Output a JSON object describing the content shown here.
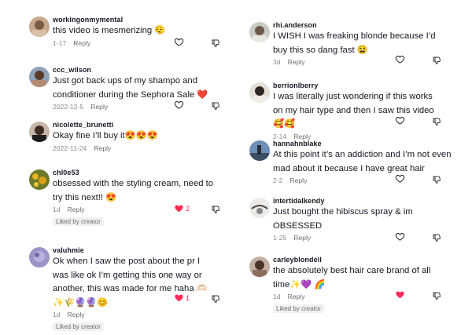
{
  "left_column": [
    {
      "username": "workingonmymental",
      "text": "this video is mesmerizing 😮‍💨",
      "date": "1-17",
      "reply": "Reply",
      "likes": "",
      "liked_by_creator": ""
    },
    {
      "username": "ccc_wilson",
      "text": "Just got back ups of my shampo and conditioner during the Sephora Sale ❤️",
      "date": "2022-12-5",
      "reply": "Reply",
      "likes": "",
      "liked_by_creator": ""
    },
    {
      "username": "nicolette_brunetti",
      "text": "Okay fine I’ll buy it😍😍😍",
      "date": "2022-11-24",
      "reply": "Reply",
      "likes": "",
      "liked_by_creator": ""
    },
    {
      "username": "chl0e53",
      "text": "obsessed with the styling cream, need to try this next!! 😍",
      "date": "1d",
      "reply": "Reply",
      "likes": "2",
      "liked_by_creator": "Liked by creator"
    },
    {
      "username": "valuhmie",
      "text": "Ok when I saw the post about the pr I was like ok I’m getting this one way or another, this was made for me haha 🫶🏻✨🌾🔮🔮😊",
      "date": "1d",
      "reply": "Reply",
      "likes": "1",
      "liked_by_creator": "Liked by creator"
    }
  ],
  "right_column": [
    {
      "username": "rhi.anderson",
      "text": "I WISH I was freaking blonde because I’d buy this so dang fast 😫",
      "date": "3d",
      "reply": "Reply",
      "likes": "",
      "liked_by_creator": ""
    },
    {
      "username": "berrionlberry",
      "text": "I was literally just wondering if this works on my hair type and then I saw this video 🥰🥰",
      "date": "2-14",
      "reply": "Reply",
      "likes": "",
      "liked_by_creator": ""
    },
    {
      "username": "hannahnblake",
      "text": "At this point it’s an addiction and I’m not even mad about it because I have great hair",
      "date": "2-2",
      "reply": "Reply",
      "likes": "",
      "liked_by_creator": ""
    },
    {
      "username": "intertidalkendy",
      "text": "Just bought the hibiscus spray & im OBSESSED",
      "date": "1-25",
      "reply": "Reply",
      "likes": "",
      "liked_by_creator": ""
    },
    {
      "username": "carleyblondell",
      "text": "the absolutely best hair care brand of all time✨💜 🌈",
      "date": "1d",
      "reply": "Reply",
      "likes": "",
      "liked_by_creator": "Liked by creator"
    }
  ],
  "icons": {
    "like": "heart-outline-icon",
    "liked": "heart-filled-icon",
    "dislike": "thumbs-down-icon"
  },
  "colors": {
    "liked_heart": "#fe2c55",
    "meta_gray": "#8a8b91"
  }
}
